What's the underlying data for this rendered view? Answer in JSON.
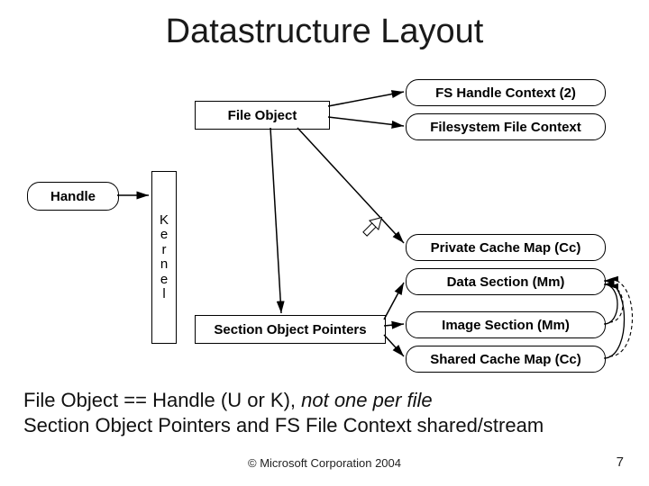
{
  "title": "Datastructure Layout",
  "boxes": {
    "handle": "Handle",
    "kernel_letters": [
      "K",
      "e",
      "r",
      "n",
      "e",
      "l"
    ],
    "file_object": "File Object",
    "section_pointers": "Section Object Pointers",
    "fs_handle_ctx": "FS Handle Context (2)",
    "fs_file_ctx": "Filesystem File Context",
    "priv_cache": "Private Cache Map (Cc)",
    "data_section": "Data Section (Mm)",
    "image_section": "Image Section (Mm)",
    "shared_cache": "Shared Cache Map (Cc)"
  },
  "body_line1_a": "File Object == Handle (U or K), ",
  "body_line1_b": "not one per file",
  "body_line2": "Section Object Pointers and FS File Context shared/stream",
  "footer": "© Microsoft Corporation 2004",
  "page": "7"
}
